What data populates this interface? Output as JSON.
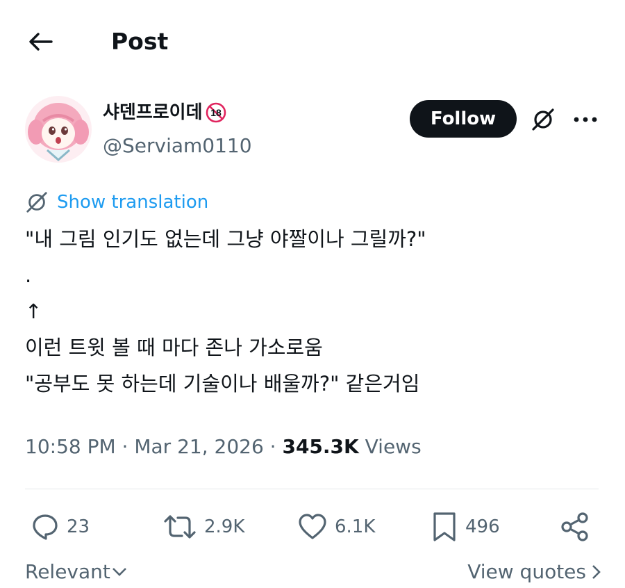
{
  "header": {
    "title": "Post"
  },
  "author": {
    "display_name": "샤덴프로이데",
    "badge_text": "18",
    "handle": "@Serviam0110",
    "follow_label": "Follow"
  },
  "translation": {
    "label": "Show translation"
  },
  "tweet": {
    "lines": [
      "\"내 그림 인기도 없는데 그냥 야짤이나 그릴까?\"",
      ".",
      "↑",
      "이런 트윗 볼 때 마다 존나 가소로움",
      "\"공부도 못 하는데 기술이나 배울까?\" 같은거임"
    ]
  },
  "meta": {
    "time": "10:58 PM",
    "separator": " · ",
    "date": "Mar 21, 2026",
    "views_count": "345.3K",
    "views_label": " Views"
  },
  "actions": {
    "replies": "23",
    "reposts": "2.9K",
    "likes": "6.1K",
    "bookmarks": "496"
  },
  "footer": {
    "sort_label": "Relevant",
    "view_quotes_label": "View quotes"
  },
  "colors": {
    "accent": "#1d9bf0",
    "text": "#0f1419",
    "secondary": "#536471",
    "badge_red": "#e0245e"
  },
  "icons": {
    "back": "arrow-left-icon",
    "grok": "grok-icon",
    "more": "more-horizontal-icon",
    "translate": "translate-icon",
    "reply": "reply-icon",
    "repost": "repost-icon",
    "like": "heart-icon",
    "bookmark": "bookmark-icon",
    "share": "share-icon"
  }
}
